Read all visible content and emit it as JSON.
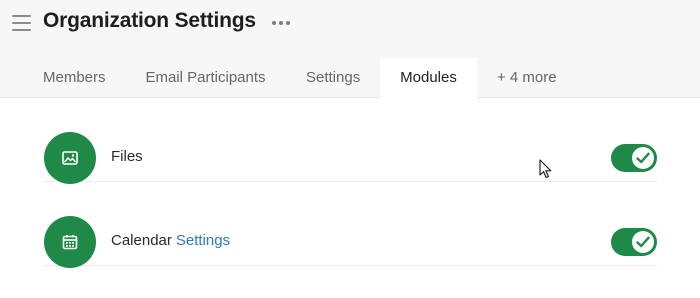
{
  "header": {
    "title": "Organization Settings",
    "menu_icon": "hamburger-menu-icon",
    "more_icon": "more-horizontal-icon"
  },
  "tabs": [
    {
      "label": "Members",
      "active": false
    },
    {
      "label": "Email Participants",
      "active": false
    },
    {
      "label": "Settings",
      "active": false
    },
    {
      "label": "Modules",
      "active": true
    },
    {
      "label": "+ 4 more",
      "active": false
    }
  ],
  "modules": [
    {
      "label": "Files",
      "link": "",
      "icon": "image-icon",
      "enabled": true
    },
    {
      "label": "Calendar",
      "link": "Settings",
      "icon": "calendar-icon",
      "enabled": true
    }
  ],
  "colors": {
    "accent_green": "#1f8a47",
    "link_blue": "#2f7ac0",
    "header_bg": "#f7f7f7",
    "content_bg": "#ffffff"
  }
}
